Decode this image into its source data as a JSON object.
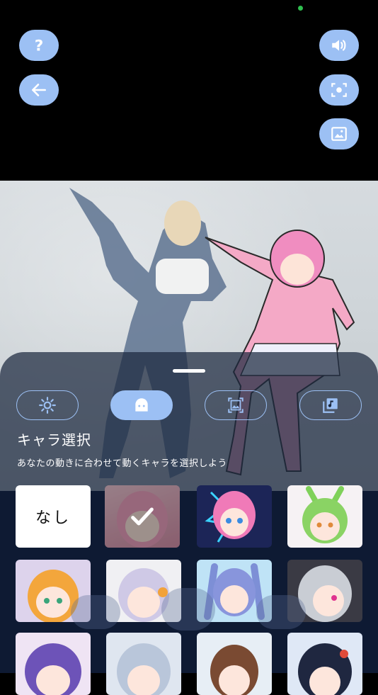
{
  "toolbar": {
    "help_icon": "question-icon",
    "back_icon": "arrow-left-icon",
    "sound_icon": "volume-icon",
    "capture_icon": "camera-focus-icon",
    "background_icon": "image-icon"
  },
  "tabs": [
    {
      "name": "effect",
      "icon": "sun-icon",
      "active": false
    },
    {
      "name": "character",
      "icon": "character-face-icon",
      "active": true
    },
    {
      "name": "background",
      "icon": "image-frame-icon",
      "active": false
    },
    {
      "name": "music",
      "icon": "music-library-icon",
      "active": false
    }
  ],
  "panel": {
    "title": "キャラ選択",
    "subtitle": "あなたの動きに合わせて動くキャラを選択しよう"
  },
  "characters": {
    "none_label": "なし",
    "selected_index": 1
  },
  "colors": {
    "accent": "#9cc0f4",
    "panel": "#1c283e",
    "grid_bg": "#0e1a33"
  }
}
